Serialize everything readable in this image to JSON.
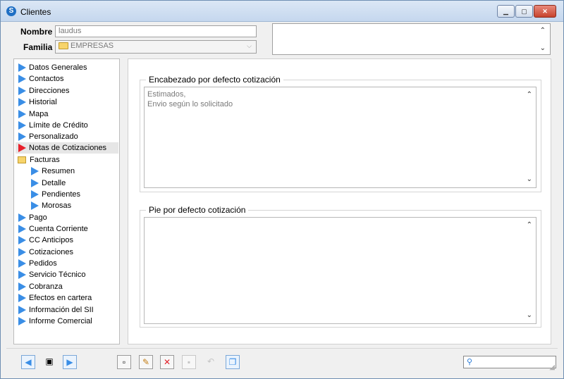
{
  "window": {
    "title": "Clientes"
  },
  "header": {
    "nombre_label": "Nombre",
    "nombre_value": "laudus",
    "familia_label": "Familia",
    "familia_value": "EMPRESAS"
  },
  "nav": {
    "items": [
      {
        "label": "Datos Generales",
        "icon": "blue-triangle-icon"
      },
      {
        "label": "Contactos",
        "icon": "blue-triangle-icon"
      },
      {
        "label": "Direcciones",
        "icon": "blue-triangle-icon"
      },
      {
        "label": "Historial",
        "icon": "blue-triangle-icon"
      },
      {
        "label": "Mapa",
        "icon": "blue-triangle-icon"
      },
      {
        "label": "Límite de Crédito",
        "icon": "blue-triangle-icon"
      },
      {
        "label": "Personalizado",
        "icon": "blue-triangle-icon"
      },
      {
        "label": "Notas de Cotizaciones",
        "icon": "red-triangle-icon"
      },
      {
        "label": "Facturas",
        "icon": "folder-icon"
      },
      {
        "label": "Resumen",
        "icon": "blue-triangle-icon"
      },
      {
        "label": "Detalle",
        "icon": "blue-triangle-icon"
      },
      {
        "label": "Pendientes",
        "icon": "blue-triangle-icon"
      },
      {
        "label": "Morosas",
        "icon": "blue-triangle-icon"
      },
      {
        "label": "Pago",
        "icon": "blue-triangle-icon"
      },
      {
        "label": "Cuenta Corriente",
        "icon": "blue-triangle-icon"
      },
      {
        "label": "CC Anticipos",
        "icon": "blue-triangle-icon"
      },
      {
        "label": "Cotizaciones",
        "icon": "blue-triangle-icon"
      },
      {
        "label": "Pedidos",
        "icon": "blue-triangle-icon"
      },
      {
        "label": "Servicio Técnico",
        "icon": "blue-triangle-icon"
      },
      {
        "label": "Cobranza",
        "icon": "blue-triangle-icon"
      },
      {
        "label": "Efectos en cartera",
        "icon": "blue-triangle-icon"
      },
      {
        "label": "Información del SII",
        "icon": "blue-triangle-icon"
      },
      {
        "label": "Informe Comercial",
        "icon": "blue-triangle-icon"
      }
    ]
  },
  "main": {
    "header_group_title": "Encabezado por defecto cotización",
    "header_text_line1": "Estimados,",
    "header_text_line2": "Envio según lo solicitado",
    "footer_group_title": "Pie por defecto cotización",
    "footer_text": ""
  },
  "colors": {
    "accent_blue": "#3a8ee6",
    "selected_red": "#e8202a",
    "delete_red": "#e2222a"
  }
}
